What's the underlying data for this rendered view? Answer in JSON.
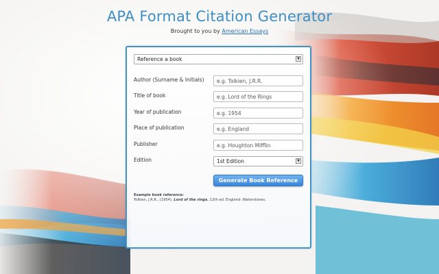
{
  "header": {
    "title": "APA Format Citation Generator",
    "tagline_prefix": "Brought to you by",
    "tagline_link": "American Essays"
  },
  "form": {
    "type_select": {
      "selected": "Reference a book"
    },
    "fields": [
      {
        "label": "Author (Surname & Initials)",
        "placeholder": "e.g. Tolkien, J.R.R."
      },
      {
        "label": "Title of book",
        "placeholder": "e.g. Lord of the Rings"
      },
      {
        "label": "Year of publication",
        "placeholder": "e.g. 1954"
      },
      {
        "label": "Place of publication",
        "placeholder": "e.g. England"
      },
      {
        "label": "Publisher",
        "placeholder": "e.g. Houghton Mifflin"
      }
    ],
    "edition": {
      "label": "Edition",
      "selected": "1st Edition"
    },
    "generate_button": "Generate Book Reference"
  },
  "example": {
    "heading": "Example book reference:",
    "prefix": "Tolkien, J.R.R., (1954).",
    "title": "Lord of the rings.",
    "suffix": "12th ed. England: Waterstones."
  },
  "colors": {
    "accent": "#3e8ec6",
    "button": "#3a85d7"
  }
}
